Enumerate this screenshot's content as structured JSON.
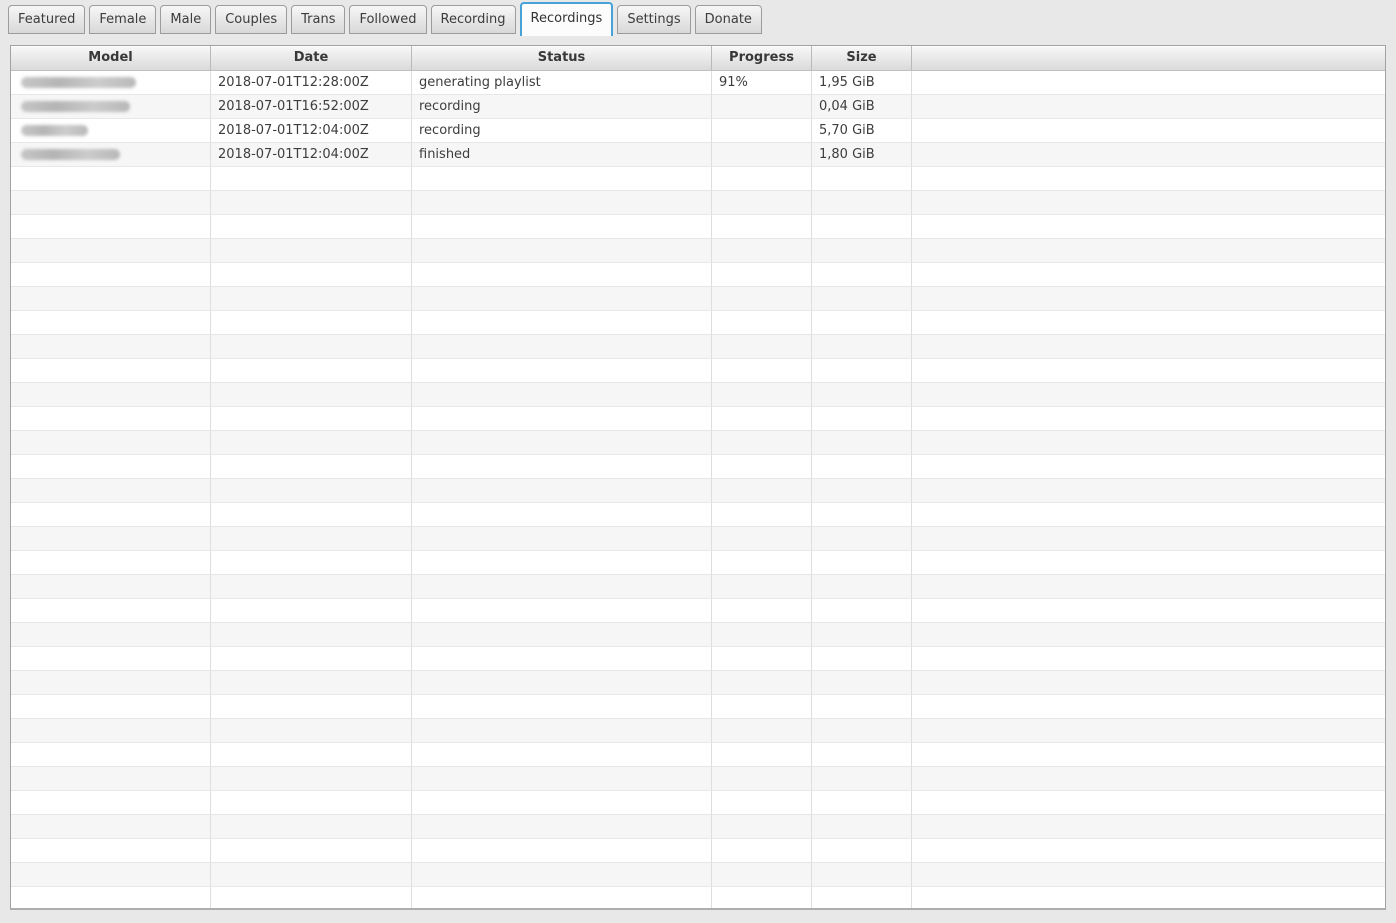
{
  "tabs": [
    {
      "label": "Featured",
      "selected": false
    },
    {
      "label": "Female",
      "selected": false
    },
    {
      "label": "Male",
      "selected": false
    },
    {
      "label": "Couples",
      "selected": false
    },
    {
      "label": "Trans",
      "selected": false
    },
    {
      "label": "Followed",
      "selected": false
    },
    {
      "label": "Recording",
      "selected": false
    },
    {
      "label": "Recordings",
      "selected": true
    },
    {
      "label": "Settings",
      "selected": false
    },
    {
      "label": "Donate",
      "selected": false
    }
  ],
  "table": {
    "columns": [
      {
        "label": "Model"
      },
      {
        "label": "Date"
      },
      {
        "label": "Status"
      },
      {
        "label": "Progress"
      },
      {
        "label": "Size"
      },
      {
        "label": ""
      }
    ],
    "rows": [
      {
        "model_redacted": true,
        "model_redacted_width": 115,
        "date": "2018-07-01T12:28:00Z",
        "status": "generating playlist",
        "progress": "91%",
        "size": "1,95 GiB"
      },
      {
        "model_redacted": true,
        "model_redacted_width": 109,
        "date": "2018-07-01T16:52:00Z",
        "status": "recording",
        "progress": "",
        "size": "0,04 GiB"
      },
      {
        "model_redacted": true,
        "model_redacted_width": 67,
        "date": "2018-07-01T12:04:00Z",
        "status": "recording",
        "progress": "",
        "size": "5,70 GiB"
      },
      {
        "model_redacted": true,
        "model_redacted_width": 99,
        "date": "2018-07-01T12:04:00Z",
        "status": "finished",
        "progress": "",
        "size": "1,80 GiB"
      }
    ],
    "empty_row_count": 31
  },
  "colors": {
    "selected_tab_border": "#47a3d7",
    "window_background": "#e8e8e8",
    "row_stripe": "#f6f6f6",
    "header_text": "#383838",
    "cell_text": "#3d3d3d"
  }
}
